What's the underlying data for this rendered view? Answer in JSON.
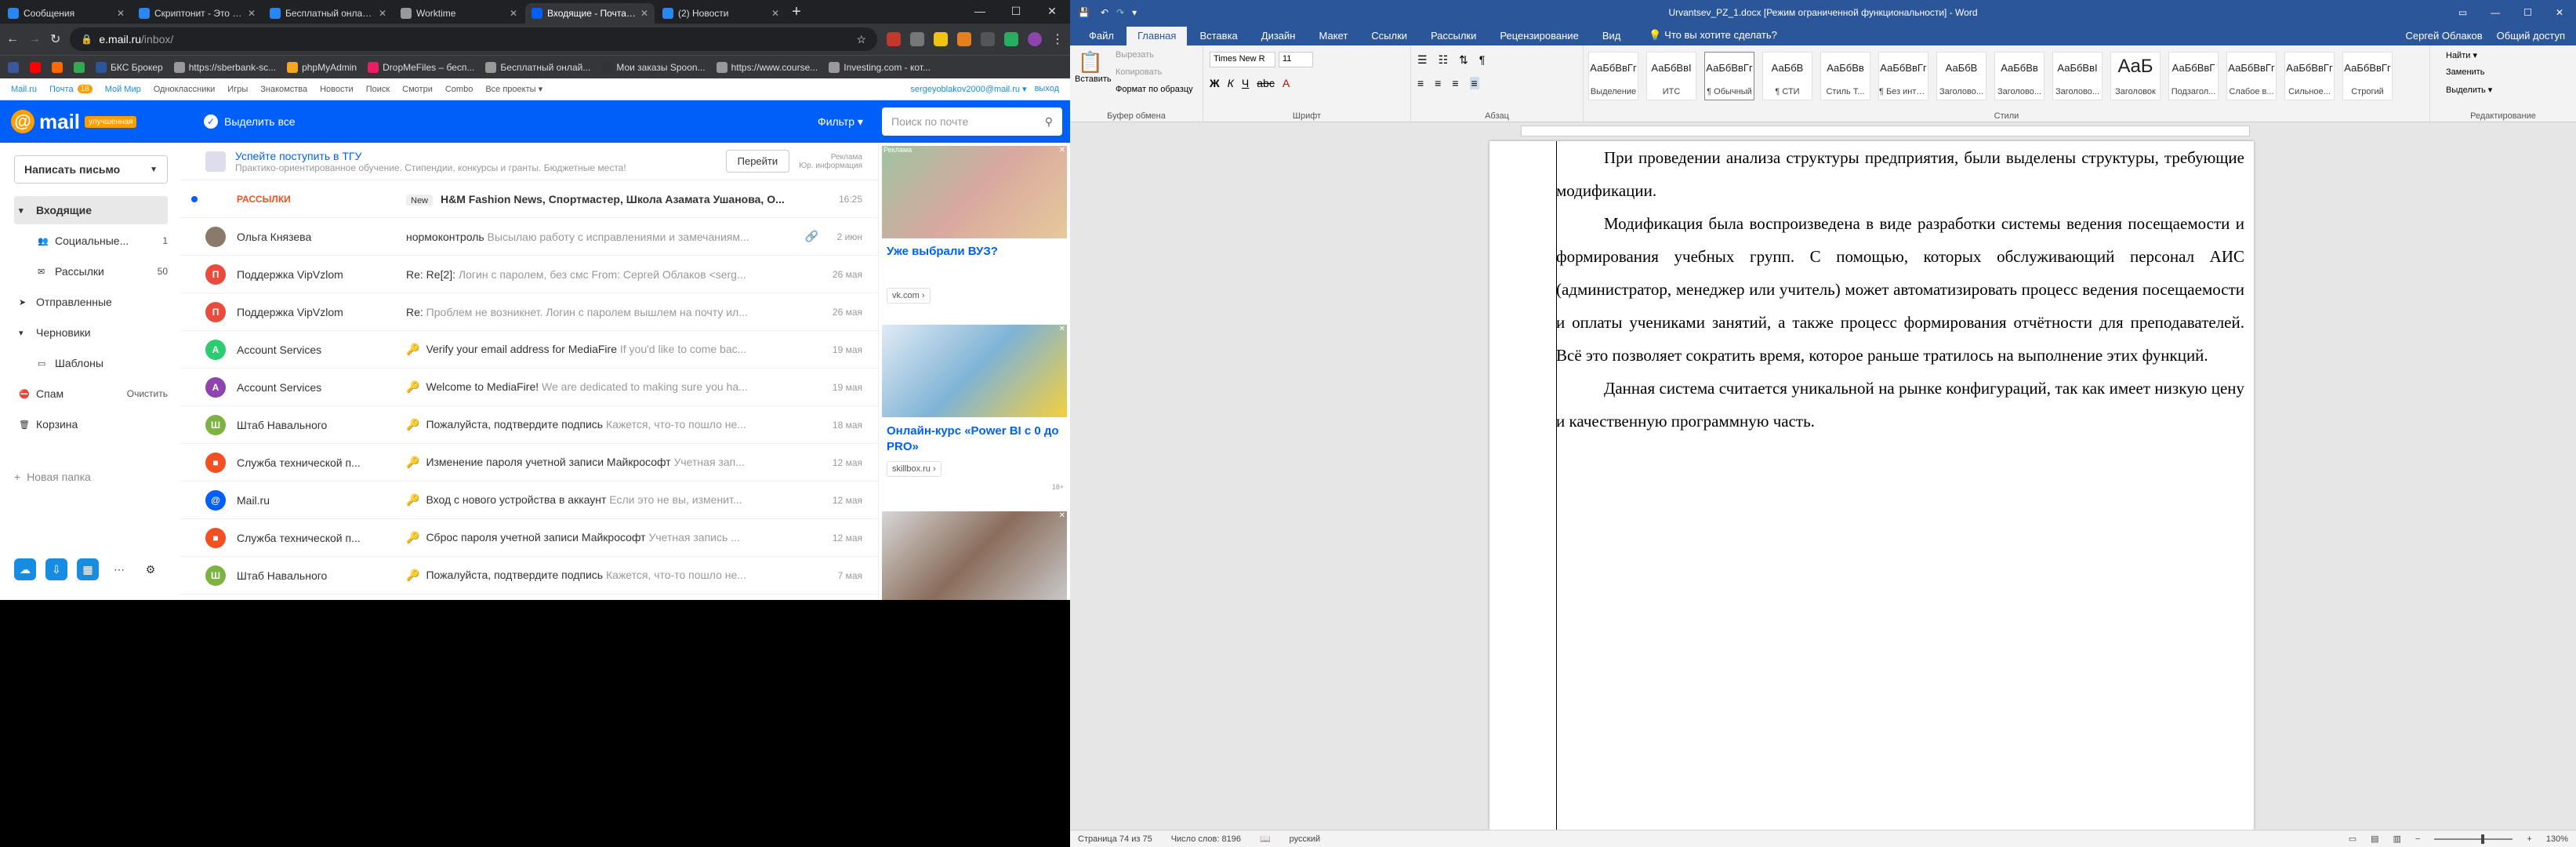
{
  "browser": {
    "tabs": [
      {
        "label": "Сообщения",
        "color": "#2787f5"
      },
      {
        "label": "Скриптонит - Это Ло...",
        "color": "#2787f5"
      },
      {
        "label": "Бесплатный онлайн р...",
        "color": "#2787f5"
      },
      {
        "label": "Worktime",
        "color": "#999999"
      },
      {
        "label": "Входящие - Почта Ma...",
        "color": "#005ff9"
      },
      {
        "label": "(2) Новости",
        "color": "#2787f5"
      }
    ],
    "new_tab": "+",
    "window_controls": {
      "minimize": "—",
      "maximize": "☐",
      "close": "✕"
    },
    "url_host": "e.mail.ru",
    "url_path": "/inbox/",
    "bookmarks": [
      {
        "label": "Mail.ru",
        "color": "#005ff9"
      },
      {
        "label": "Почта",
        "badge": "18",
        "color": "#005ff9"
      },
      {
        "label": "Мой Мир",
        "color": "#005ff9"
      },
      {
        "label": "Одноклассники",
        "color": "#f5a623"
      },
      {
        "label": "Игры",
        "color": "#555"
      },
      {
        "label": "Знакомства",
        "color": "#555"
      },
      {
        "label": "Новости",
        "color": "#555"
      },
      {
        "label": "Поиск",
        "color": "#555"
      },
      {
        "label": "Смотри",
        "color": "#555"
      },
      {
        "label": "Combo",
        "color": "#555"
      },
      {
        "label": "Все проекты ▾",
        "color": "#555"
      }
    ],
    "bar_bookmarks": [
      {
        "label": "",
        "color": "#3b5998"
      },
      {
        "label": "",
        "color": "#ff0000"
      },
      {
        "label": "",
        "color": "#ff6a00"
      },
      {
        "label": "",
        "color": "#34a853"
      },
      {
        "label": "БКС Брокер",
        "color": "#2b579a"
      },
      {
        "label": "https://sberbank-sc...",
        "color": "#999"
      },
      {
        "label": "phpMyAdmin",
        "color": "#f5a623"
      },
      {
        "label": "DropMeFiles – бесп...",
        "color": "#e91e63"
      },
      {
        "label": "Бесплатный онлай...",
        "color": "#999"
      },
      {
        "label": "Мои заказы Spoon...",
        "color": "#333"
      },
      {
        "label": "https://www.course...",
        "color": "#999"
      },
      {
        "label": "Investing.com - кот...",
        "color": "#999"
      }
    ]
  },
  "mail": {
    "account": "sergeyoblakov2000@mail.ru ▾",
    "logout": "выход",
    "logo_text": "mail",
    "logo_badge": "улучшенная",
    "select_all": "Выделить все",
    "filter": "Фильтр ▾",
    "search_placeholder": "Поиск по почте",
    "compose": "Написать письмо",
    "folders": [
      {
        "label": "Входящие",
        "count": "",
        "active": true,
        "indent": false,
        "icon": "▾"
      },
      {
        "label": "Социальные...",
        "count": "1",
        "active": false,
        "indent": true,
        "icon": "👥"
      },
      {
        "label": "Рассылки",
        "count": "50",
        "active": false,
        "indent": true,
        "icon": "✉"
      },
      {
        "label": "Отправленные",
        "count": "",
        "active": false,
        "indent": false,
        "icon": "➤"
      },
      {
        "label": "Черновики",
        "count": "",
        "active": false,
        "indent": false,
        "icon": "▾"
      },
      {
        "label": "Шаблоны",
        "count": "",
        "active": false,
        "indent": true,
        "icon": "▭"
      },
      {
        "label": "Спам",
        "count": "Очистить",
        "active": false,
        "indent": false,
        "icon": "⛔"
      },
      {
        "label": "Корзина",
        "count": "",
        "active": false,
        "indent": false,
        "icon": "🗑"
      }
    ],
    "new_folder": "Новая папка",
    "promo": {
      "title": "Успейте поступить в ТГУ",
      "snippet": "Практико-ориентированное обучение. Стипендии, конкурсы и гранты. Бюджетные места!",
      "button": "Перейти",
      "ad_label": "Реклама",
      "ad_info": "Юр. информация"
    },
    "rows": [
      {
        "sender": "РАССЫЛКИ",
        "badge": "New",
        "subject": "H&M Fashion News, Спортмастер, Школа Азамата Ушанова, О...",
        "snippet": "",
        "date": "16:25",
        "unread": true,
        "avatar": "",
        "avcolor": "#ffffff",
        "key": false,
        "clip": false
      },
      {
        "sender": "Ольга Князева",
        "badge": "",
        "subject": "нормоконтроль",
        "snippet": " Высылаю работу с исправлениями и замечаниям...",
        "date": "2 июн",
        "unread": false,
        "avatar": "",
        "avcolor": "#8a7a6a",
        "key": false,
        "clip": true
      },
      {
        "sender": "Поддержка VipVzlom",
        "badge": "",
        "subject": "Re: Re[2]:",
        "snippet": " Логин с паролем, без смс From: Сергей Облаков <serg...",
        "date": "26 мая",
        "unread": false,
        "avatar": "П",
        "avcolor": "#e74c3c",
        "key": false,
        "clip": false
      },
      {
        "sender": "Поддержка VipVzlom",
        "badge": "",
        "subject": "Re:",
        "snippet": " Проблем не возникнет. Логин с паролем вышлем на почту ил...",
        "date": "26 мая",
        "unread": false,
        "avatar": "П",
        "avcolor": "#e74c3c",
        "key": false,
        "clip": false
      },
      {
        "sender": "Account Services",
        "badge": "",
        "subject": "Verify your email address for MediaFire",
        "snippet": " If you'd like to come bac...",
        "date": "19 мая",
        "unread": false,
        "avatar": "A",
        "avcolor": "#2ecc71",
        "key": true,
        "clip": false
      },
      {
        "sender": "Account Services",
        "badge": "",
        "subject": "Welcome to MediaFire!",
        "snippet": " We are dedicated to making sure you ha...",
        "date": "19 мая",
        "unread": false,
        "avatar": "A",
        "avcolor": "#8e44ad",
        "key": true,
        "clip": false
      },
      {
        "sender": "Штаб Навального",
        "badge": "",
        "subject": "Пожалуйста, подтвердите подпись",
        "snippet": " Кажется, что-то пошло не...",
        "date": "18 мая",
        "unread": false,
        "avatar": "Ш",
        "avcolor": "#7cb342",
        "key": true,
        "clip": false
      },
      {
        "sender": "Служба технической п...",
        "badge": "",
        "subject": "Изменение пароля учетной записи Майкрософт",
        "snippet": " Учетная зап...",
        "date": "12 мая",
        "unread": false,
        "avatar": "■",
        "avcolor": "#f25022",
        "key": true,
        "clip": false
      },
      {
        "sender": "Mail.ru",
        "badge": "",
        "subject": "Вход с нового устройства в аккаунт",
        "snippet": " Если это не вы, изменит...",
        "date": "12 мая",
        "unread": false,
        "avatar": "@",
        "avcolor": "#005ff9",
        "key": true,
        "clip": false
      },
      {
        "sender": "Служба технической п...",
        "badge": "",
        "subject": "Сброс пароля учетной записи Майкрософт",
        "snippet": " Учетная запись ...",
        "date": "12 мая",
        "unread": false,
        "avatar": "■",
        "avcolor": "#f25022",
        "key": true,
        "clip": false
      },
      {
        "sender": "Штаб Навального",
        "badge": "",
        "subject": "Пожалуйста, подтвердите подпись",
        "snippet": " Кажется, что-то пошло не...",
        "date": "7 мая",
        "unread": false,
        "avatar": "Ш",
        "avcolor": "#7cb342",
        "key": true,
        "clip": false
      }
    ],
    "ads": [
      {
        "label": "Реклама",
        "title": "Уже выбрали ВУЗ?",
        "source": "vk.com ›"
      },
      {
        "title": "Онлайн-курс «Power BI с 0 до PRO»",
        "source": "skillbox.ru ›",
        "age": "18+"
      }
    ]
  },
  "word": {
    "title": "Urvantsev_PZ_1.docx [Режим ограниченной функциональности] - Word",
    "user": "Сергей Облаков",
    "share": "Общий доступ",
    "tabs": [
      "Файл",
      "Главная",
      "Вставка",
      "Дизайн",
      "Макет",
      "Ссылки",
      "Рассылки",
      "Рецензирование",
      "Вид"
    ],
    "tell_me": "Что вы хотите сделать?",
    "clipboard": {
      "paste": "Вставить",
      "cut": "Вырезать",
      "copy": "Копировать",
      "format": "Формат по образцу",
      "group": "Буфер обмена"
    },
    "font": {
      "name": "Times New R",
      "size": "11",
      "group": "Шрифт"
    },
    "paragraph_group": "Абзац",
    "styles_group": "Стили",
    "styles": [
      {
        "sample": "АаБбВвГг",
        "name": "Выделение"
      },
      {
        "sample": "АаБбВвІ",
        "name": "ИТС"
      },
      {
        "sample": "АаБбВвГг",
        "name": "¶ Обычный"
      },
      {
        "sample": "АаБбВ",
        "name": "¶ СТИ"
      },
      {
        "sample": "АаБбВв",
        "name": "Стиль Т..."
      },
      {
        "sample": "АаБбВвГг",
        "name": "¶ Без инте..."
      },
      {
        "sample": "АаБбВ",
        "name": "Заголово..."
      },
      {
        "sample": "АаБбВв",
        "name": "Заголово..."
      },
      {
        "sample": "АаБбВвІ",
        "name": "Заголово..."
      },
      {
        "sample": "AaБ",
        "name": "Заголовок"
      },
      {
        "sample": "АаБбВвГ",
        "name": "Подзагол..."
      },
      {
        "sample": "АаБбВвГг",
        "name": "Слабое в..."
      },
      {
        "sample": "АаБбВвГг",
        "name": "Сильное..."
      },
      {
        "sample": "АаБбВвГг",
        "name": "Строгий"
      }
    ],
    "editing": {
      "find": "Найти ▾",
      "replace": "Заменить",
      "select": "Выделить ▾",
      "group": "Редактирование"
    },
    "paragraphs": [
      "При проведении анализа структуры предприятия, были выделены структуры, требующие модификации.",
      "Модификация была воспроизведена в виде разработки системы ведения посещаемости и формирования учебных групп. С помощью, которых обслуживающий персонал АИС (администратор, менеджер или учитель) может автоматизировать процесс ведения посещаемости и оплаты учениками занятий, а также процесс формирования отчётности для преподавателей. Всё это позволяет сократить время, которое раньше тратилось на выполнение этих функций.",
      "Данная система считается уникальной на рынке конфигураций, так как имеет низкую цену и качественную программную часть."
    ],
    "status": {
      "page": "Страница 74 из 75",
      "words": "Число слов: 8196",
      "lang": "русский",
      "zoom": "130%"
    }
  }
}
